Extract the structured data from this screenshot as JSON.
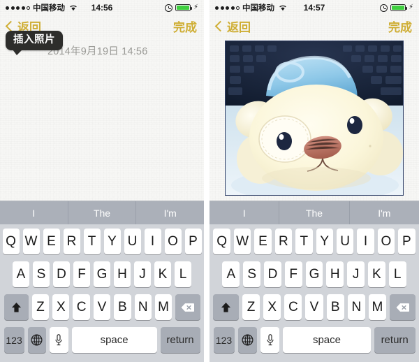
{
  "panels": [
    {
      "id": "left",
      "status": {
        "carrier": "中国移动",
        "time": "14:56",
        "signal_filled": 4,
        "signal_total": 5
      },
      "nav": {
        "back_label": "返回",
        "done_label": "完成"
      },
      "note": {
        "datestamp": "2014年9月19日  14:56",
        "has_photo": false
      },
      "tooltip": {
        "text": "插入照片",
        "visible": true
      }
    },
    {
      "id": "right",
      "status": {
        "carrier": "中国移动",
        "time": "14:57",
        "signal_filled": 4,
        "signal_total": 5
      },
      "nav": {
        "back_label": "返回",
        "done_label": "完成"
      },
      "note": {
        "datestamp": "",
        "has_photo": true,
        "photo_alt": "白色毛绒小熊玩偶照片"
      },
      "tooltip": {
        "text": "",
        "visible": false
      }
    }
  ],
  "keyboard": {
    "predictions": [
      "I",
      "The",
      "I'm"
    ],
    "row1": [
      "Q",
      "W",
      "E",
      "R",
      "T",
      "Y",
      "U",
      "I",
      "O",
      "P"
    ],
    "row2": [
      "A",
      "S",
      "D",
      "F",
      "G",
      "H",
      "J",
      "K",
      "L"
    ],
    "row3": [
      "Z",
      "X",
      "C",
      "V",
      "B",
      "N",
      "M"
    ],
    "shift_icon": "shift-arrow-icon",
    "delete_icon": "backspace-icon",
    "numeric_label": "123",
    "globe_icon": "globe-icon",
    "mic_icon": "microphone-icon",
    "space_label": "space",
    "return_label": "return"
  },
  "colors": {
    "accent_gold": "#cfae34",
    "paper": "#f7f7f5",
    "keyboard_bg": "#d1d4d9",
    "predict_bg": "#abb0b9",
    "key_gray": "#a8adb6",
    "battery_green": "#3fcf3f",
    "tooltip_bg": "#2d2d2b"
  }
}
